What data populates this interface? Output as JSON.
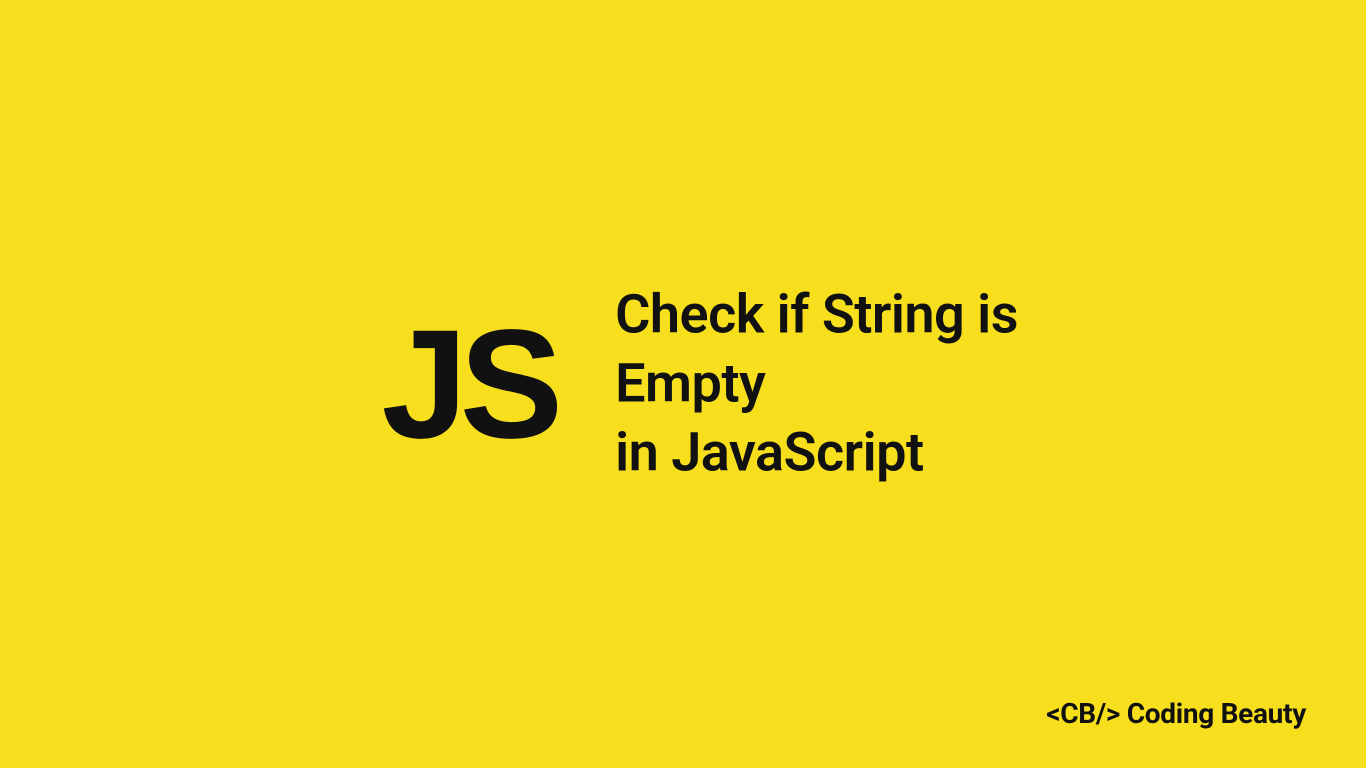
{
  "badge": {
    "label": "JS"
  },
  "title": {
    "line1": "Check if String is Empty",
    "line2": "in JavaScript"
  },
  "brand": {
    "text": "<CB/> Coding Beauty"
  },
  "colors": {
    "background": "#F7DF1E",
    "text": "#111111"
  }
}
